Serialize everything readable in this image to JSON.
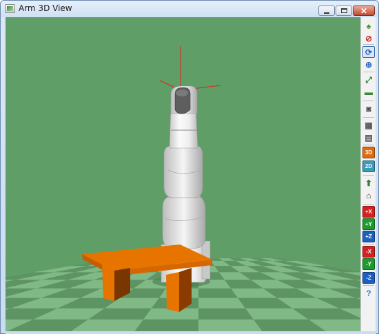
{
  "window": {
    "title": "Arm 3D View"
  },
  "colors": {
    "viewport_background": "#5f9f67",
    "floor_light": "#80b886",
    "floor_dark": "#5e9463",
    "robot": "#eaeaea",
    "table": "#e87400",
    "table_shadow": "#8a3c00",
    "axis_red": "#e02020"
  },
  "toolbar": {
    "buttons": [
      {
        "name": "teapot-icon",
        "glyph": "♠",
        "color": "#4a8a2a",
        "boxed": false
      },
      {
        "name": "no-collision-icon",
        "glyph": "⊘",
        "color": "#d02020",
        "boxed": false
      },
      {
        "name": "rotate-view-icon",
        "glyph": "⟳",
        "color": "#1d5fc0",
        "boxed": false,
        "active": true
      },
      {
        "name": "pan-view-icon",
        "glyph": "⊕",
        "color": "#1d5fc0",
        "boxed": false
      },
      {
        "name": "fit-view-icon",
        "glyph": "⤢",
        "color": "#2a7a2a",
        "boxed": false
      },
      {
        "name": "ruler-icon",
        "glyph": "▬",
        "color": "#3a8a3a",
        "boxed": false
      },
      {
        "name": "camera-icon",
        "glyph": "◙",
        "color": "#444444",
        "boxed": false
      },
      {
        "name": "record-icon",
        "glyph": "▦",
        "color": "#555555",
        "boxed": false
      },
      {
        "name": "movie-icon",
        "glyph": "▤",
        "color": "#555555",
        "boxed": false
      },
      {
        "name": "view-3d-icon",
        "label": "3D",
        "color": "#e06a10",
        "boxed": true
      },
      {
        "name": "view-2d-icon",
        "label": "2D",
        "color": "#3a9ab8",
        "boxed": true
      },
      {
        "name": "axis-view-icon",
        "glyph": "⬆",
        "color": "#3a7a3a",
        "boxed": false
      },
      {
        "name": "home-view-icon",
        "glyph": "⌂",
        "color": "#333333",
        "boxed": false
      },
      {
        "name": "plus-x-view-icon",
        "label": "+X",
        "color": "#d42020",
        "boxed": true
      },
      {
        "name": "plus-y-view-icon",
        "label": "+Y",
        "color": "#1e9a2a",
        "boxed": true
      },
      {
        "name": "plus-z-view-icon",
        "label": "+Z",
        "color": "#1d5fc0",
        "boxed": true
      },
      {
        "name": "minus-x-view-icon",
        "label": "-X",
        "color": "#d42020",
        "boxed": true
      },
      {
        "name": "minus-y-view-icon",
        "label": "-Y",
        "color": "#1e9a2a",
        "boxed": true
      },
      {
        "name": "minus-z-view-icon",
        "label": "-Z",
        "color": "#1d5fc0",
        "boxed": true
      },
      {
        "name": "help-icon",
        "glyph": "?",
        "color": "#3a78d0",
        "boxed": false
      }
    ]
  }
}
